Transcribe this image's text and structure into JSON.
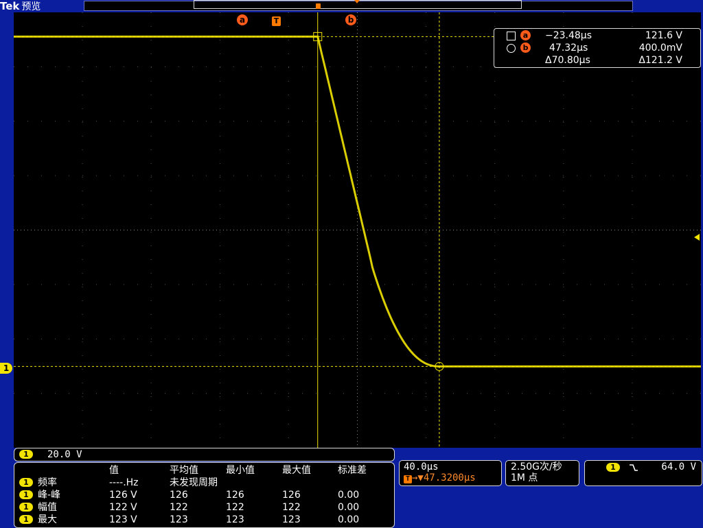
{
  "header": {
    "brand": "Tek",
    "mode": "预览",
    "trigger_marker": "T"
  },
  "cursors": {
    "a_label": "a",
    "b_label": "b",
    "trigger_label": "T"
  },
  "channel_marker": "1",
  "cursor_readout": {
    "a": {
      "label": "a",
      "time": "−23.48µs",
      "value": "121.6 V"
    },
    "b": {
      "label": "b",
      "time": "47.32µs",
      "value": "400.0mV"
    },
    "delta": {
      "time": "Δ70.80µs",
      "value": "Δ121.2 V"
    }
  },
  "channel_scale": {
    "badge": "1",
    "scale": "20.0 V"
  },
  "measurements": {
    "headers": [
      "值",
      "平均值",
      "最小值",
      "最大值",
      "标准差"
    ],
    "rows": [
      {
        "badge": "1",
        "name": "频率",
        "value": "----.Hz",
        "mean": "未发现周期",
        "min": "",
        "max": "",
        "std": ""
      },
      {
        "badge": "1",
        "name": "峰-峰",
        "value": "126 V",
        "mean": "126",
        "min": "126",
        "max": "126",
        "std": "0.00"
      },
      {
        "badge": "1",
        "name": "幅值",
        "value": "122 V",
        "mean": "122",
        "min": "122",
        "max": "122",
        "std": "0.00"
      },
      {
        "badge": "1",
        "name": "最大",
        "value": "123 V",
        "mean": "123",
        "min": "123",
        "max": "123",
        "std": "0.00"
      }
    ]
  },
  "timebase": {
    "scale": "40.0µs",
    "position_prefix": "T",
    "position": "→▼47.3200µs"
  },
  "acquisition": {
    "rate": "2.50G次/秒",
    "length": "1M 点"
  },
  "trigger": {
    "badge": "1",
    "slope_icon": "falling-edge-icon",
    "level": "64.0 V"
  },
  "colors": {
    "trace": "#f2e400",
    "cursor": "#ff5b1a",
    "background": "#0b1f9e",
    "screen": "#000000"
  },
  "waveform": {
    "high_level_V": 121.6,
    "low_level_V": 0.4,
    "fall_start_us": -23.48,
    "settle_us": 47.32,
    "volts_per_div": 20,
    "us_per_div": 40
  }
}
